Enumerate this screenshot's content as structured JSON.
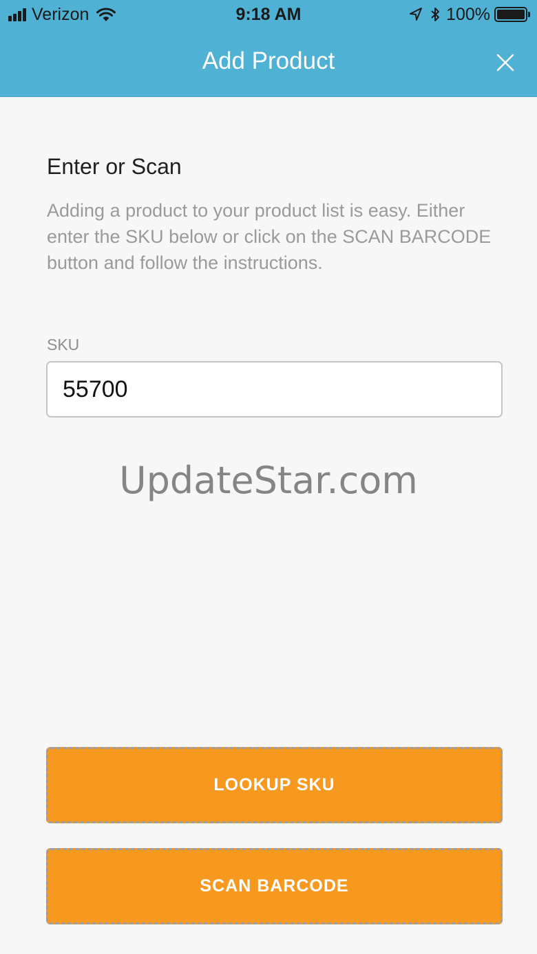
{
  "status_bar": {
    "carrier": "Verizon",
    "time": "9:18 AM",
    "battery": "100%",
    "battery_level": 1.0,
    "icons": [
      "signal-icon",
      "wifi-icon",
      "location-arrow-icon",
      "bluetooth-icon",
      "battery-icon"
    ]
  },
  "header": {
    "title": "Add Product",
    "close_icon": "close-icon",
    "background": "#4fb1d4"
  },
  "content": {
    "section_title": "Enter or Scan",
    "description": "Adding a product to your product list is easy. Either enter the SKU below or click on the SCAN BARCODE button and follow the instructions.",
    "sku_label": "SKU",
    "sku_value": "55700"
  },
  "watermark": "UpdateStar.com",
  "buttons": {
    "lookup": "LOOKUP SKU",
    "scan": "SCAN BARCODE",
    "color": "#f7991f"
  }
}
